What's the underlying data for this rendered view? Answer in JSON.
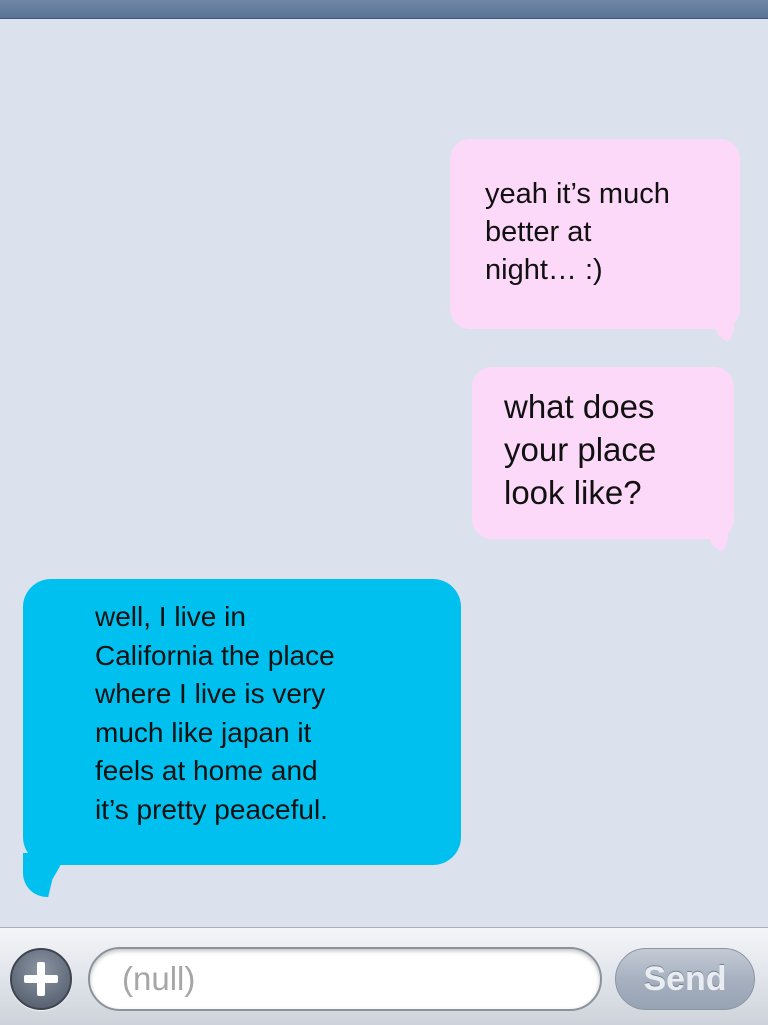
{
  "thread": {
    "messages": [
      {
        "direction": "outgoing",
        "text": "yeah it’s much\nbetter at\nnight… :)"
      },
      {
        "direction": "outgoing",
        "text": "what does\nyour place\nlook like?"
      },
      {
        "direction": "incoming",
        "text": "well, I live in\nCalifornia the place\nwhere I live is very\nmuch like japan it\nfeels at home and\nit’s pretty peaceful."
      }
    ]
  },
  "composer": {
    "add_icon": "plus-icon",
    "input_placeholder": "(null)",
    "input_value": "",
    "send_label": "Send"
  },
  "colors": {
    "background": "#dbe2ed",
    "outgoing_bubble": "#fdd9f9",
    "incoming_bubble": "#00c0f0",
    "nav_bar": "#5a7396"
  }
}
